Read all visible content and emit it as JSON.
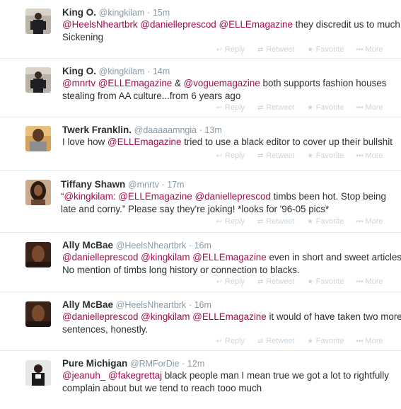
{
  "actions": {
    "reply": "Reply",
    "retweet": "Retweet",
    "favorite": "Favorite",
    "more": "More",
    "reply_icon": "reply-icon",
    "retweet_icon": "retweet-icon",
    "favorite_icon": "star-icon",
    "more_icon": "dots-icon"
  },
  "colors": {
    "mention": "#a30c4c",
    "meta": "#8899a6",
    "action": "#ccd6dd",
    "divider": "#e1e8ed"
  },
  "tweets": [
    {
      "name": "King O.",
      "handle": "@kingkilam",
      "sep": "·",
      "time": "15m",
      "line1": {
        "m1": "@HeelsNheartbrk",
        "m2": "@danielleprescod",
        "m3": "@ELLEmagazine",
        "t": "they discredit us to much."
      },
      "line2": "Sickening"
    },
    {
      "name": "King O.",
      "handle": "@kingkilam",
      "sep": "·",
      "time": "14m",
      "line1": {
        "m1": "@mnrtv",
        "m2": "@ELLEmagazine",
        "amp": "&",
        "m3": "@voguemagazine",
        "t": "both supports fashion houses"
      },
      "line2": "stealing from AA culture...from 6 years ago"
    },
    {
      "name": "Twerk Franklin.",
      "handle": "@daaaaamngia",
      "sep": "·",
      "time": "13m",
      "line1": {
        "t1": "I love how",
        "m1": "@ELLEmagazine",
        "t2": "tried to use a black editor to cover up their bullshit"
      }
    },
    {
      "name": "Tiffany Shawn",
      "handle": "@mnrtv",
      "sep": "·",
      "time": "17m",
      "line1": {
        "q": "“",
        "m1": "@kingkilam:",
        "m2": "@ELLEmagazine",
        "m3": "@danielleprescod",
        "t": "timbs been hot. Stop being"
      },
      "line2": "late and corny.” Please say they're joking! *looks for '96-05 pics*"
    },
    {
      "name": "Ally McBae",
      "handle": "@HeelsNheartbrk",
      "sep": "·",
      "time": "16m",
      "line1": {
        "m1": "@danielleprescod",
        "m2": "@kingkilam",
        "m3": "@ELLEmagazine",
        "t": "even in short and sweet articles."
      },
      "line2": "No mention of timbs long history or connection to blacks."
    },
    {
      "name": "Ally McBae",
      "handle": "@HeelsNheartbrk",
      "sep": "·",
      "time": "16m",
      "line1": {
        "m1": "@danielleprescod",
        "m2": "@kingkilam",
        "m3": "@ELLEmagazine",
        "t": "it would of have taken two more"
      },
      "line2": "sentences, honestly."
    },
    {
      "name": "Pure Michigan",
      "handle": "@RMForDie",
      "sep": "·",
      "time": "12m",
      "line1": {
        "m1": "@jeanuh_",
        "m2": "@fakegrettaj",
        "t": "black people man I mean true we got a lot to rightfully"
      },
      "line2": "complain about but we tend to reach tooo much"
    }
  ]
}
